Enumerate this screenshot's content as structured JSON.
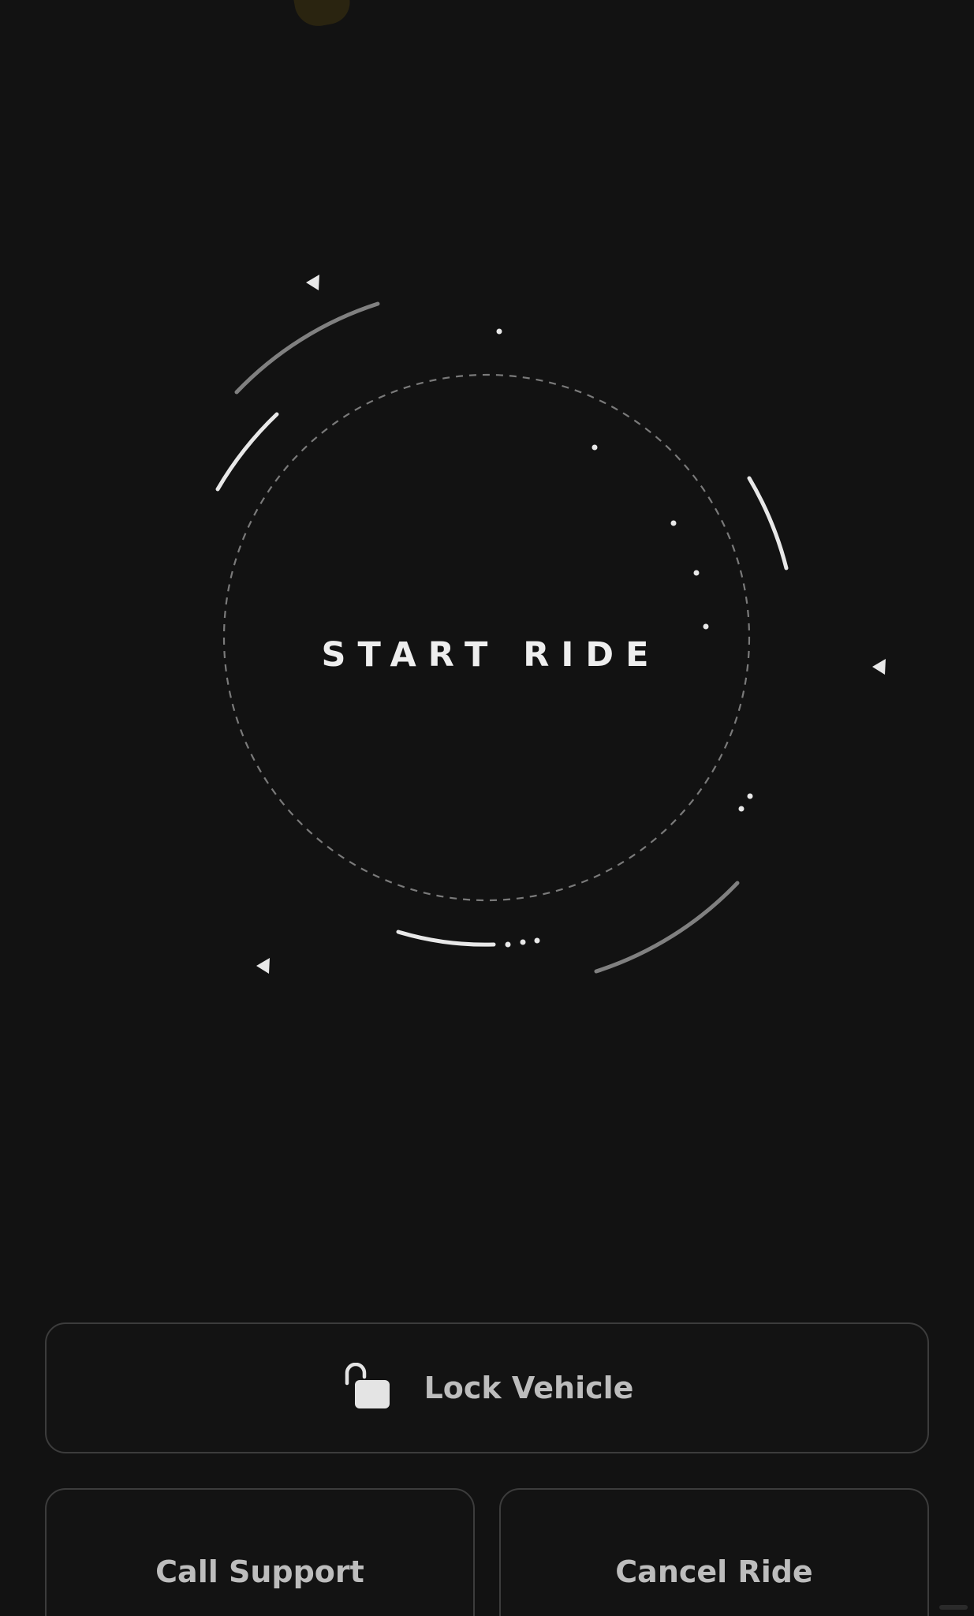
{
  "ride": {
    "start_label": "START RIDE"
  },
  "actions": {
    "lock_label": "Lock Vehicle",
    "support_label": "Call Support",
    "cancel_label": "Cancel Ride"
  },
  "icons": {
    "lock": "unlocked-padlock-icon"
  },
  "colors": {
    "background": "#121212",
    "button_border": "#3c3c3c",
    "button_text": "#bdbdbd",
    "ring_bright": "#e8e8e8",
    "ring_dim": "#808080",
    "title_text": "#eeeeee"
  }
}
